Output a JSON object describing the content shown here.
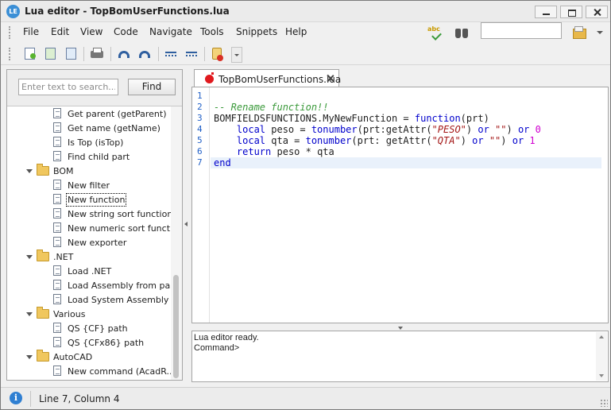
{
  "window": {
    "title": "Lua editor - TopBomUserFunctions.lua",
    "app_icon_text": "LE"
  },
  "menu": {
    "items": [
      "File",
      "Edit",
      "View",
      "Code",
      "Navigate",
      "Tools",
      "Snippets",
      "Help"
    ],
    "spell_icon_text": "abc",
    "search_value": ""
  },
  "toolbar": {
    "icons": [
      "new-file-icon",
      "new-file-green-icon",
      "new-file-blue-icon",
      "print-icon",
      "undo-icon",
      "redo-icon",
      "indent-icon",
      "outdent-icon",
      "snippet-icon"
    ]
  },
  "snippets": {
    "search_placeholder": "Enter text to search...",
    "find_label": "Find",
    "items": [
      {
        "label": "Get parent (getParent)",
        "type": "leaf"
      },
      {
        "label": "Get name (getName)",
        "type": "leaf"
      },
      {
        "label": "Is Top (isTop)",
        "type": "leaf"
      },
      {
        "label": "Find child part",
        "type": "leaf"
      },
      {
        "label": "BOM",
        "type": "folder"
      },
      {
        "label": "New filter",
        "type": "leaf"
      },
      {
        "label": "New function",
        "type": "leaf",
        "selected": true
      },
      {
        "label": "New string sort function",
        "type": "leaf"
      },
      {
        "label": "New numeric sort funct...",
        "type": "leaf"
      },
      {
        "label": "New exporter",
        "type": "leaf"
      },
      {
        "label": ".NET",
        "type": "folder"
      },
      {
        "label": "Load .NET",
        "type": "leaf"
      },
      {
        "label": "Load Assembly from pa...",
        "type": "leaf"
      },
      {
        "label": "Load System Assembly ...",
        "type": "leaf"
      },
      {
        "label": "Various",
        "type": "folder"
      },
      {
        "label": "QS {CF} path",
        "type": "leaf"
      },
      {
        "label": "QS {CFx86} path",
        "type": "leaf"
      },
      {
        "label": "AutoCAD",
        "type": "folder"
      },
      {
        "label": "New command (AcadR...",
        "type": "leaf"
      }
    ]
  },
  "editor": {
    "tab_label": "TopBomUserFunctions.lua",
    "line_numbers": [
      "1",
      "2",
      "3",
      "4",
      "5",
      "6",
      "7"
    ],
    "current_line": 7,
    "lines": [
      [],
      [
        {
          "t": "-- Rename function!!",
          "c": "comment"
        }
      ],
      [
        {
          "t": "BOMFIELDSFUNCTIONS.MyNewFunction = "
        },
        {
          "t": "function",
          "c": "kw"
        },
        {
          "t": "(prt)"
        }
      ],
      [
        {
          "t": "    "
        },
        {
          "t": "local",
          "c": "kw"
        },
        {
          "t": " peso = "
        },
        {
          "t": "tonumber",
          "c": "kw"
        },
        {
          "t": "(prt:getAttr("
        },
        {
          "t": "\"PESO\"",
          "c": "str"
        },
        {
          "t": ") "
        },
        {
          "t": "or",
          "c": "kw"
        },
        {
          "t": " "
        },
        {
          "t": "\"\"",
          "c": "str"
        },
        {
          "t": ") "
        },
        {
          "t": "or",
          "c": "kw"
        },
        {
          "t": " "
        },
        {
          "t": "0",
          "c": "num"
        }
      ],
      [
        {
          "t": "    "
        },
        {
          "t": "local",
          "c": "kw"
        },
        {
          "t": " qta = "
        },
        {
          "t": "tonumber",
          "c": "kw"
        },
        {
          "t": "(prt: getAttr("
        },
        {
          "t": "\"QTA\"",
          "c": "str"
        },
        {
          "t": ") "
        },
        {
          "t": "or",
          "c": "kw"
        },
        {
          "t": " "
        },
        {
          "t": "\"\"",
          "c": "str"
        },
        {
          "t": ") "
        },
        {
          "t": "or",
          "c": "kw"
        },
        {
          "t": " "
        },
        {
          "t": "1",
          "c": "num"
        }
      ],
      [
        {
          "t": "    "
        },
        {
          "t": "return",
          "c": "kw"
        },
        {
          "t": " peso * qta"
        }
      ],
      [
        {
          "t": "end",
          "c": "kw"
        }
      ]
    ]
  },
  "output": {
    "lines": [
      "Lua editor ready.",
      "Command>"
    ]
  },
  "status": {
    "text": "Line 7, Column 4"
  }
}
